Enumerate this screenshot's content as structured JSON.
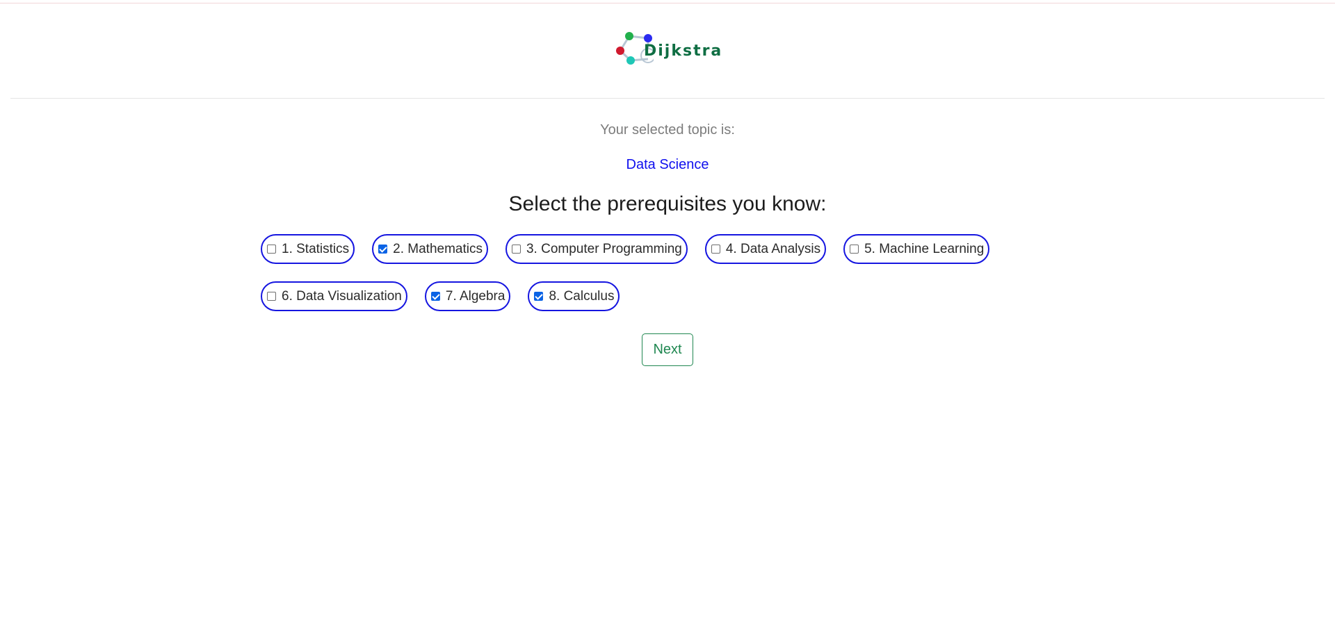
{
  "header": {
    "logo_text": "Dijkstra",
    "logo_colors": {
      "green": "#22b04c",
      "blue": "#2b2bf0",
      "red": "#d0192e",
      "teal": "#1fc7b6",
      "text": "#0f6e43"
    }
  },
  "selection": {
    "subtitle": "Your selected topic is:",
    "topic": "Data Science"
  },
  "prerequisites": {
    "heading": "Select the prerequisites you know:",
    "items": [
      {
        "label": "1. Statistics",
        "checked": false
      },
      {
        "label": "2. Mathematics",
        "checked": true
      },
      {
        "label": "3. Computer Programming",
        "checked": false
      },
      {
        "label": "4. Data Analysis",
        "checked": false
      },
      {
        "label": "5. Machine Learning",
        "checked": false
      },
      {
        "label": "6. Data Visualization",
        "checked": false
      },
      {
        "label": "7. Algebra",
        "checked": true
      },
      {
        "label": "8. Calculus",
        "checked": true
      }
    ]
  },
  "actions": {
    "next_label": "Next"
  },
  "colors": {
    "chip_border": "#1515e0",
    "topic_text": "#1010ee",
    "next_button": "#1f8750",
    "checkbox_checked": "#0b63e5"
  }
}
